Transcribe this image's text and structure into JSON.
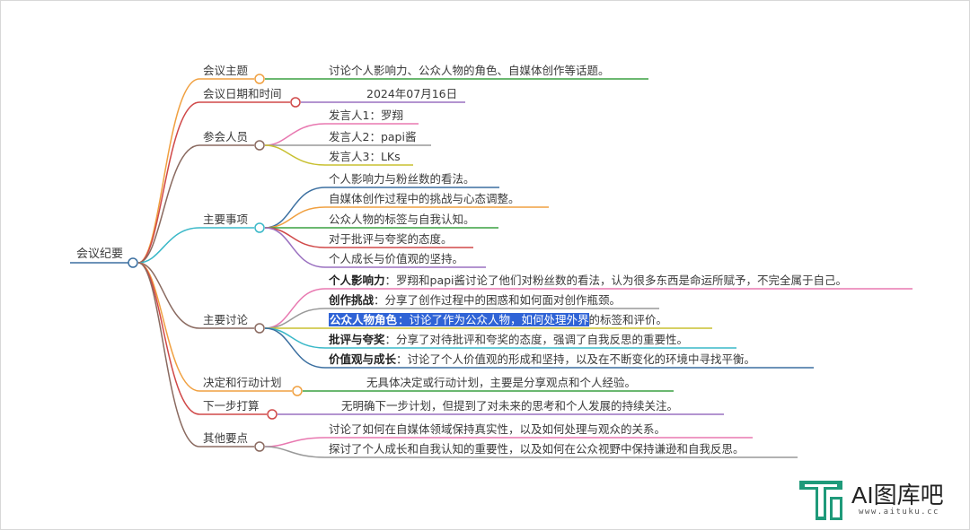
{
  "root": "会议纪要",
  "branches": {
    "topic": {
      "label": "会议主题",
      "items": [
        "讨论个人影响力、公众人物的角色、自媒体创作等话题。"
      ]
    },
    "date": {
      "label": "会议日期和时间",
      "items": [
        "2024年07月16日"
      ]
    },
    "attendees": {
      "label": "参会人员",
      "items": [
        "发言人1：罗翔",
        "发言人2：papi酱",
        "发言人3：LKs"
      ]
    },
    "matters": {
      "label": "主要事项",
      "items": [
        "个人影响力与粉丝数的看法。",
        "自媒体创作过程中的挑战与心态调整。",
        "公众人物的标签与自我认知。",
        "对于批评与夸奖的态度。",
        "个人成长与价值观的坚持。"
      ]
    },
    "discussion": {
      "label": "主要讨论",
      "items": [
        {
          "title": "个人影响力",
          "text": "：罗翔和papi酱讨论了他们对粉丝数的看法，认为很多东西是命运所赋予，不完全属于自己。"
        },
        {
          "title": "创作挑战",
          "text": "：分享了创作过程中的困惑和如何面对创作瓶颈。"
        },
        {
          "title": "公众人物角色",
          "text": "：讨论了作为公众人物，如何处理外界的标签和评价。",
          "hl_text": "：讨论了作为公众人物，如何处理外界",
          "rest_text": "的标签和评价。"
        },
        {
          "title": "批评与夸奖",
          "text": "：分享了对待批评和夸奖的态度，强调了自我反思的重要性。"
        },
        {
          "title": "价值观与成长",
          "text": "：讨论了个人价值观的形成和坚持，以及在不断变化的环境中寻找平衡。"
        }
      ]
    },
    "decisions": {
      "label": "决定和行动计划",
      "items": [
        "无具体决定或行动计划，主要是分享观点和个人经验。"
      ]
    },
    "next": {
      "label": "下一步打算",
      "items": [
        "无明确下一步计划，但提到了对未来的思考和个人发展的持续关注。"
      ]
    },
    "other": {
      "label": "其他要点",
      "items": [
        "讨论了如何在自媒体领域保持真实性，以及如何处理与观众的关系。",
        "探讨了个人成长和自我认知的重要性，以及如何在公众视野中保持谦逊和自我反思。"
      ]
    }
  },
  "logo": {
    "brand": "AI图库吧",
    "url": "www.aituku.cc"
  }
}
